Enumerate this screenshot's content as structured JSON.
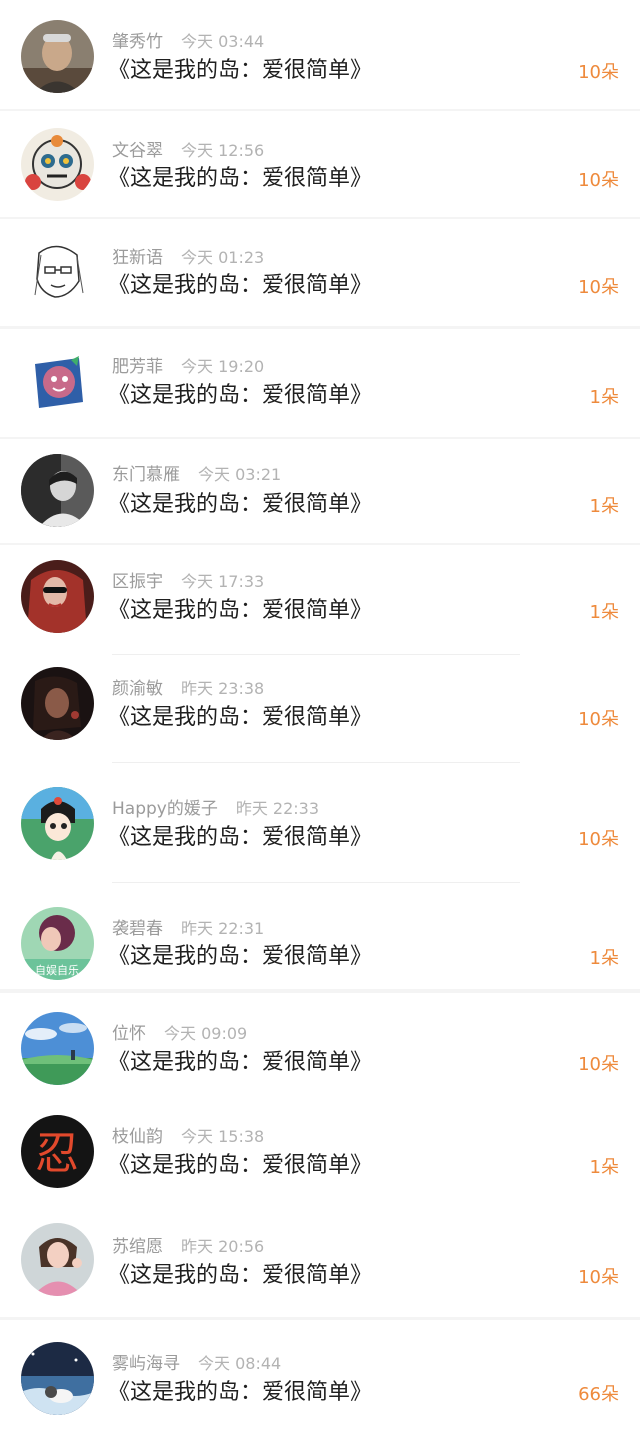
{
  "donations": [
    {
      "name": "肇秀竹",
      "time": "今天 03:44",
      "title": "《这是我的岛：爱很简单》",
      "amount": "10朵",
      "avatar": "avatar-elderly-man"
    },
    {
      "name": "文谷翠",
      "time": "今天 12:56",
      "title": "《这是我的岛：爱很简单》",
      "amount": "10朵",
      "avatar": "avatar-sugar-skull"
    },
    {
      "name": "狂新语",
      "time": "今天 01:23",
      "title": "《这是我的岛：爱很简单》",
      "amount": "10朵",
      "avatar": "avatar-sketch-portrait"
    },
    {
      "name": "肥芳菲",
      "time": "今天 19:20",
      "title": "《这是我的岛：爱很简单》",
      "amount": "1朵",
      "avatar": "avatar-cartoon-sticker"
    },
    {
      "name": "东门慕雁",
      "time": "今天 03:21",
      "title": "《这是我的岛：爱很简单》",
      "amount": "1朵",
      "avatar": "avatar-bw-photo"
    },
    {
      "name": "区振宇",
      "time": "今天 17:33",
      "title": "《这是我的岛：爱很简单》",
      "amount": "1朵",
      "avatar": "avatar-red-hair-girl"
    },
    {
      "name": "颜渝敏",
      "time": "昨天 23:38",
      "title": "《这是我的岛：爱很简单》",
      "amount": "10朵",
      "avatar": "avatar-dark-portrait"
    },
    {
      "name": "Happy的媛子",
      "time": "昨天 22:33",
      "title": "《这是我的岛：爱很简单》",
      "amount": "10朵",
      "avatar": "avatar-cartoon-princess"
    },
    {
      "name": "袭碧春",
      "time": "昨天 22:31",
      "title": "《这是我的岛：爱很简单》",
      "amount": "1朵",
      "avatar": "avatar-green-girl",
      "avatar_caption": "自娱自乐"
    },
    {
      "name": "位怀",
      "time": "今天 09:09",
      "title": "《这是我的岛：爱很简单》",
      "amount": "10朵",
      "avatar": "avatar-anime-landscape"
    },
    {
      "name": "枝仙韵",
      "time": "今天 15:38",
      "title": "《这是我的岛：爱很简单》",
      "amount": "1朵",
      "avatar": "avatar-ren-character",
      "avatar_caption": "忍"
    },
    {
      "name": "苏绾愿",
      "time": "昨天 20:56",
      "title": "《这是我的岛：爱很简单》",
      "amount": "10朵",
      "avatar": "avatar-pink-girl"
    },
    {
      "name": "雾屿海寻",
      "time": "今天 08:44",
      "title": "《这是我的岛：爱很简单》",
      "amount": "66朵",
      "avatar": "avatar-cat-seaside"
    }
  ],
  "colors": {
    "amount": "#ee8a3c",
    "title": "#1f1f1f",
    "meta": "#9b9b9b",
    "background": "#f4f4f4"
  }
}
